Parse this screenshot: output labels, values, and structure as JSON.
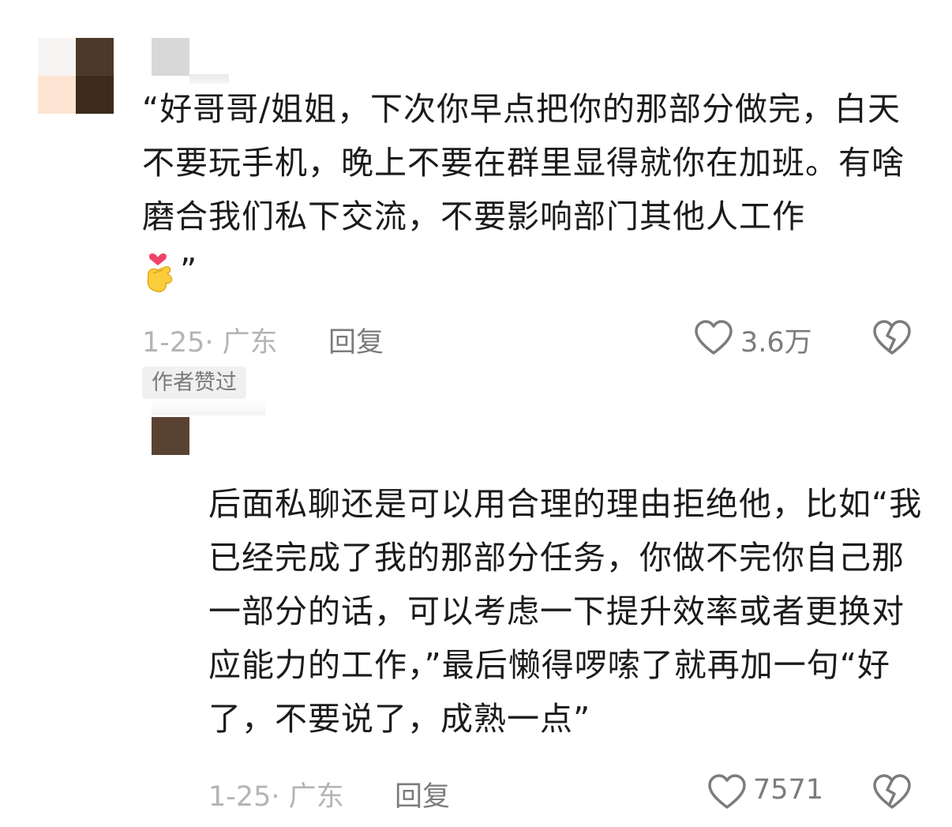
{
  "comments": [
    {
      "text": "“好哥哥/姐姐，下次你早点把你的那部分做完，白天不要玩手机，晚上不要在群里显得就你在加班。有啥磨合我们私下交流，不要影响部门其他人工作",
      "text_end": "”",
      "emoji": "finger-heart-emoji",
      "date": "1-25· 广东",
      "reply_label": "回复",
      "likes": "3.6万",
      "badge": "作者赞过"
    },
    {
      "text": "后面私聊还是可以用合理的理由拒绝他，比如“我已经完成了我的那部分任务，你做不完你自己那一部分的话，可以考虑一下提升效率或者更换对应能力的工作，”最后懒得啰嗦了就再加一句“好了，不要说了，成熟一点”",
      "date": "1-25· 广东",
      "reply_label": "回复",
      "likes": "7571"
    }
  ],
  "icons": {
    "like": "heart-outline-icon",
    "dislike": "broken-heart-icon"
  },
  "colors": {
    "text": "#1b1b1b",
    "meta": "#b4b4b4",
    "action": "#7c7c7c",
    "badge_bg": "#f0f0f0"
  }
}
